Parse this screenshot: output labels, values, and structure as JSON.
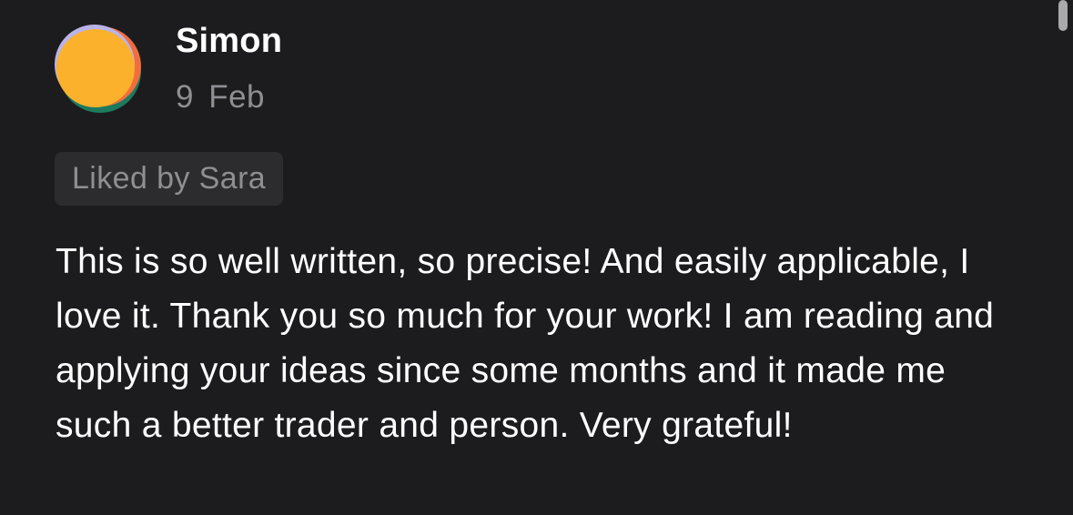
{
  "comment": {
    "author": "Simon",
    "date": "9 Feb",
    "liked_by": "Liked by Sara",
    "body": "This is so well written, so precise! And easily applicable, I love it. Thank you so much for your work! I am reading and applying your ideas since some months and it made me such a better trader and person. Very grateful!",
    "avatar_icon": "abstract-circle-avatar"
  },
  "colors": {
    "background": "#1c1c1e",
    "primary_text": "#ffffff",
    "secondary_text": "#8e8e93",
    "badge_background": "#2c2c2e",
    "avatar_yellow": "#fbb12b",
    "avatar_orange": "#f26d3d",
    "avatar_green": "#1d7a5e",
    "avatar_lavender": "#b9b4e8"
  }
}
